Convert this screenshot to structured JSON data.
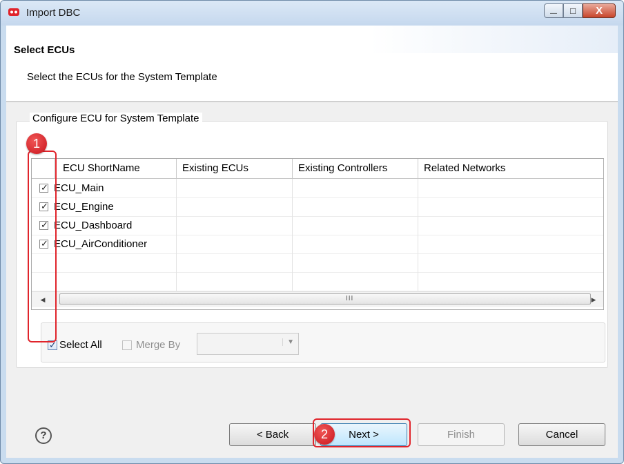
{
  "window": {
    "title": "Import DBC",
    "controls": {
      "minimize": "—",
      "maximize": "□",
      "close": "X"
    }
  },
  "header": {
    "title": "Select ECUs",
    "description": "Select the ECUs for the System Template"
  },
  "group": {
    "legend": "Configure ECU for System Template"
  },
  "table": {
    "columns": [
      "ECU ShortName",
      "Existing ECUs",
      "Existing Controllers",
      "Related Networks"
    ],
    "rows": [
      {
        "name": "ECU_Main",
        "checked": true
      },
      {
        "name": "ECU_Engine",
        "checked": true
      },
      {
        "name": "ECU_Dashboard",
        "checked": true
      },
      {
        "name": "ECU_AirConditioner",
        "checked": true
      }
    ],
    "scroll_grip": "III"
  },
  "options": {
    "select_all_label": "Select All",
    "select_all_checked": true,
    "merge_by_label": "Merge By",
    "merge_by_checked": false,
    "merge_by_value": ""
  },
  "buttons": {
    "help": "?",
    "back": "< Back",
    "next": "Next >",
    "finish": "Finish",
    "cancel": "Cancel"
  },
  "annotations": {
    "callout_1": "1",
    "callout_2": "2",
    "color": "#e0242b"
  },
  "colors": {
    "accent_default_button": "#3c7fb1",
    "titlebar": "#c9dcef"
  }
}
